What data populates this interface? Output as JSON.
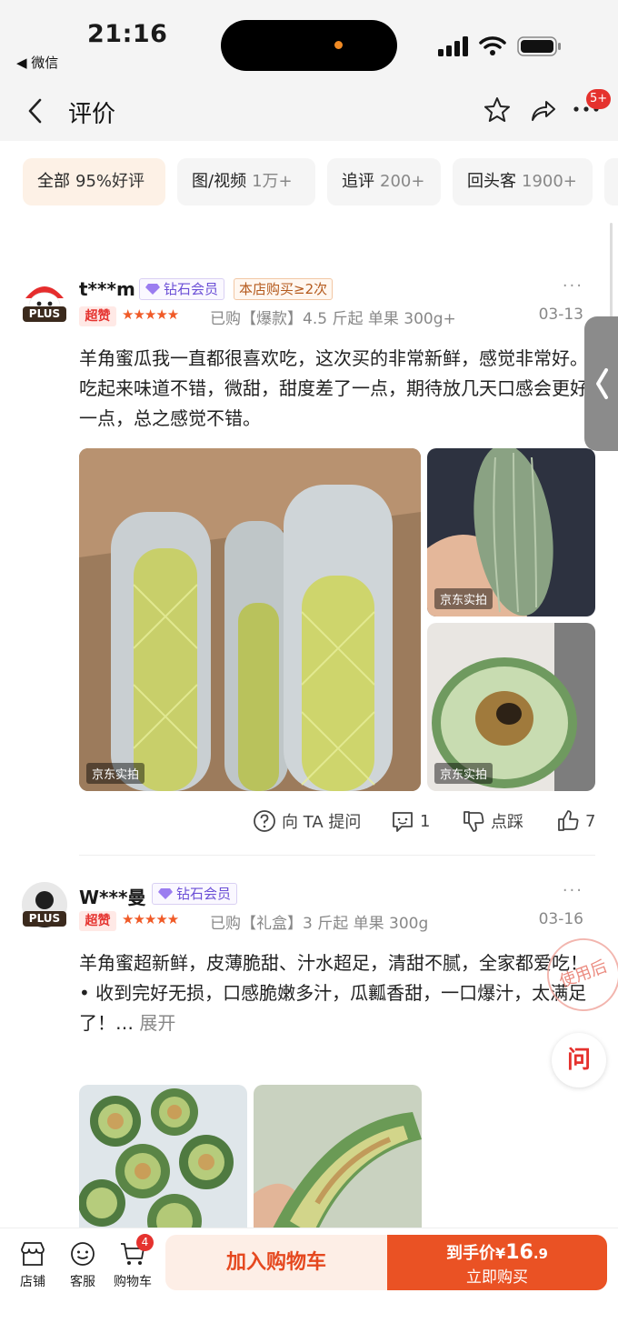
{
  "status_bar": {
    "time": "21:16",
    "back_app": "◀ 微信"
  },
  "header": {
    "title": "评价",
    "notification_badge": "5+"
  },
  "filter_tabs": [
    {
      "label": "全部",
      "count": "95%好评"
    },
    {
      "label": "图/视频",
      "count": "1万+"
    },
    {
      "label": "追评",
      "count": "200+"
    },
    {
      "label": "回头客",
      "count": "1900+"
    }
  ],
  "reviews": [
    {
      "user": "t***m",
      "plus_label": "PLUS",
      "member_badge": "钻石会员",
      "repeat_badge": "本店购买≥2次",
      "rating_tag": "超赞",
      "stars": "★★★★★",
      "spec": "已购【爆款】4.5 斤起 单果 300g+",
      "date": "03-13",
      "content": "羊角蜜瓜我一直都很喜欢吃，这次买的非常新鲜，感觉非常好。吃起来味道不错，微甜，甜度差了一点，期待放几天口感会更好一点，总之感觉不错。",
      "photo_tag": "京东实拍",
      "actions": {
        "ask": "向 TA 提问",
        "comments": "1",
        "dislike": "点踩",
        "likes": "7"
      }
    },
    {
      "user": "W***曼",
      "plus_label": "PLUS",
      "member_badge": "钻石会员",
      "rating_tag": "超赞",
      "stars": "★★★★★",
      "spec": "已购【礼盒】3 斤起 单果 300g",
      "date": "03-16",
      "content_line1": "羊角蜜超新鲜，皮薄脆甜、汁水超足，清甜不腻，全家都爱吃！",
      "content_line2": "• 收到完好无损，口感脆嫩多汁，瓜瓤香甜，一口爆汁，太满足了！…",
      "expand": "展开",
      "stamp": "使用后"
    }
  ],
  "ask_button": "问",
  "bottom_bar": {
    "store": "店铺",
    "service": "客服",
    "cart": "购物车",
    "cart_count": "4",
    "add_to_cart": "加入购物车",
    "price_label": "到手价",
    "price_symbol": "¥",
    "price_int": "16",
    "price_dec": ".9",
    "buy_now": "立即购买"
  },
  "colors": {
    "accent": "#ea5224",
    "star": "#f05a27",
    "member": "#6b4fd6"
  }
}
